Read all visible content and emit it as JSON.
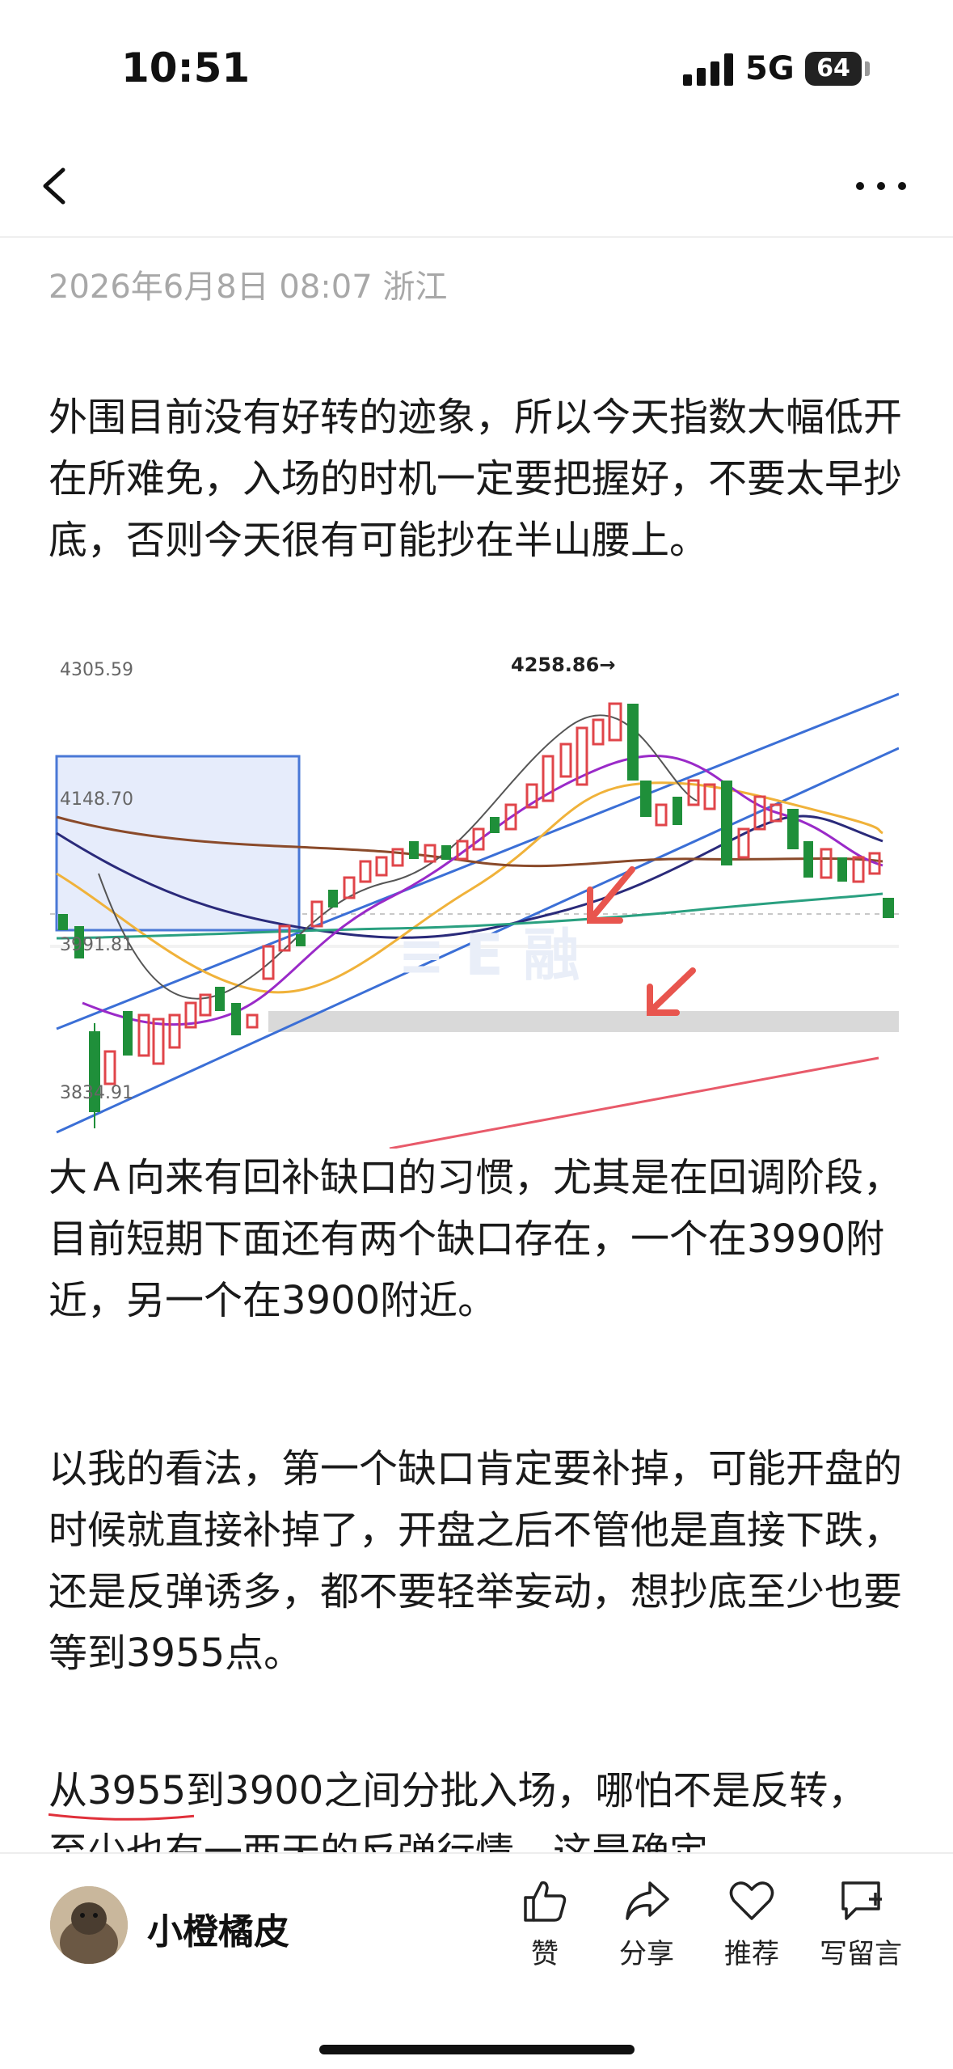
{
  "status_bar": {
    "time": "10:51",
    "network": "5G",
    "battery": "64"
  },
  "post": {
    "meta": "2026年6月8日 08:07   浙江",
    "paragraphs": {
      "p1": "外围目前没有好转的迹象，所以今天指数大幅低开在所难免，入场的时机一定要把握好，不要太早抄底，否则今天很有可能抄在半山腰上。",
      "p2": "大Ａ向来有回补缺口的习惯，尤其是在回调阶段，目前短期下面还有两个缺口存在，一个在3990附近，另一个在3900附近。",
      "p3": "以我的看法，第一个缺口肯定要补掉，可能开盘的时候就直接补掉了，开盘之后不管他是直接下跌，还是反弹诱多，都不要轻举妄动，想抄底至少也要等到3955点。",
      "p4_underlined": "从3955到3900之间分批入场，",
      "p4_rest": "哪怕不是反转，至少也有一两天的反弹行情，这是确定"
    }
  },
  "chart": {
    "price_labels": {
      "top": "4305.59",
      "mid": "4148.70",
      "lower": "3991.81",
      "bottom": "3834.91",
      "peak": "4258.86→"
    },
    "colors": {
      "up": "#e0454a",
      "down": "#1f8f3a",
      "gap_zone": "#d9d9d9",
      "box_fill": "#e6ecfb",
      "box_stroke": "#4a78d6",
      "channel": "#3b6fd6"
    }
  },
  "author": {
    "name": "小橙橘皮"
  },
  "actions": {
    "like": "赞",
    "share": "分享",
    "recommend": "推荐",
    "comment": "写留言"
  }
}
